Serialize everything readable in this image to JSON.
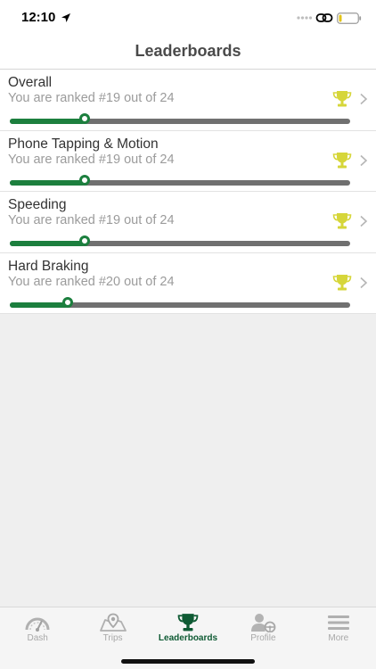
{
  "status_bar": {
    "time": "12:10",
    "location_icon": "location-arrow-icon",
    "link_icon": "link-icon",
    "battery_icon": "battery-low-icon",
    "battery_level": 0.15
  },
  "header": {
    "title": "Leaderboards"
  },
  "colors": {
    "accent_green": "#1c7f3e",
    "dark_green": "#0e5a33",
    "trophy_yellow": "#d6d63a",
    "track_gray": "#707070"
  },
  "leaderboards": [
    {
      "title": "Overall",
      "subtitle": "You are ranked #19 out of 24",
      "progress": 0.22,
      "icon": "trophy-icon"
    },
    {
      "title": "Phone Tapping & Motion",
      "subtitle": "You are ranked #19 out of 24",
      "progress": 0.22,
      "icon": "trophy-icon"
    },
    {
      "title": "Speeding",
      "subtitle": "You are ranked #19 out of 24",
      "progress": 0.22,
      "icon": "trophy-icon"
    },
    {
      "title": "Hard Braking",
      "subtitle": "You are ranked #20 out of 24",
      "progress": 0.17,
      "icon": "trophy-icon"
    }
  ],
  "tabs": [
    {
      "label": "Dash",
      "icon": "speedometer-icon",
      "active": false
    },
    {
      "label": "Trips",
      "icon": "map-pin-icon",
      "active": false
    },
    {
      "label": "Leaderboards",
      "icon": "trophy-icon",
      "active": true
    },
    {
      "label": "Profile",
      "icon": "profile-wheel-icon",
      "active": false
    },
    {
      "label": "More",
      "icon": "menu-icon",
      "active": false
    }
  ]
}
